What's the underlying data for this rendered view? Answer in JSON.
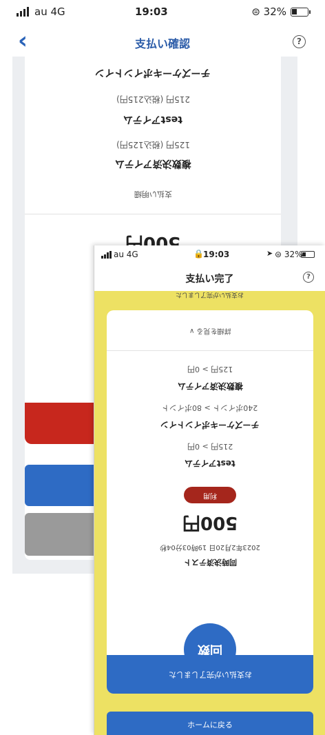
{
  "back_screen": {
    "status": {
      "carrier": "au 4G",
      "time": "19:03",
      "battery": "⊜ 32%"
    },
    "nav": {
      "back_glyph": "‹",
      "title": "支払い確認",
      "help_glyph": "?"
    },
    "receipt": {
      "rows": [
        "チーズケーキポイントイン",
        "215円 (税込215円)",
        "testアイテム",
        "125円 (税込125円)",
        "複数決済アイテム",
        "支払い明細"
      ],
      "total_fragment": "500円"
    }
  },
  "front_screen": {
    "status": {
      "carrier": "au 4G",
      "lock_glyph": "🔒",
      "time": "19:03",
      "location_glyph": "➤",
      "battery": "⊜ 32%"
    },
    "nav": {
      "title": "支払い完了",
      "help_glyph": "?"
    },
    "top_message": "お支払いが完了しました",
    "ticket": {
      "detail_toggle": "詳細を見る ∨",
      "rows": [
        "125円 > 0円",
        "複数決済アイテム",
        "240ポイント > 80ポイント",
        "チーズケーキポイントイン",
        "215円 > 0円",
        "testアイテム"
      ],
      "status_badge": "利用",
      "amount": "500円",
      "datetime": "2023年2月20日 19時03分04秒",
      "shop_name": "同時決済テスト",
      "stamp_label": "回数",
      "footer_message": "お支払いが完了しました"
    },
    "home_button": "ホームに戻る"
  },
  "colors": {
    "accent_blue": "#2e6bc4",
    "alert_red": "#c7271d",
    "yellow_bg": "#ede163",
    "badge_red": "#a5261c"
  }
}
